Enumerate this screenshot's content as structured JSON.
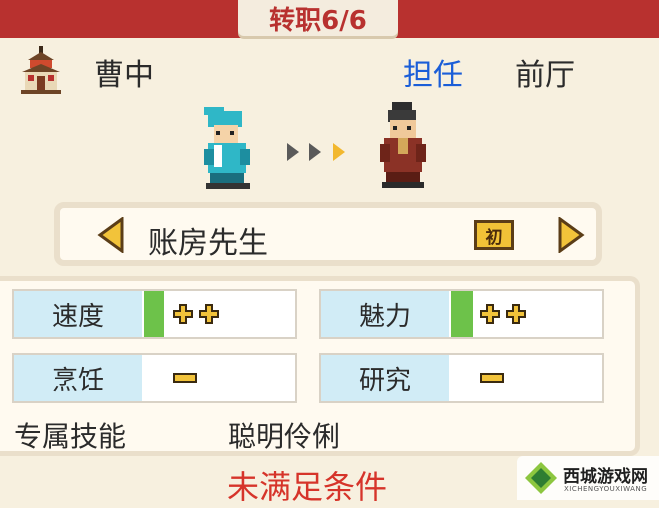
{
  "title": "转职6/6",
  "character": {
    "name": "曹中",
    "assign_label": "担任",
    "location": "前厅"
  },
  "job": {
    "name": "账房先生",
    "rank": "初"
  },
  "stats": [
    {
      "label": "速度",
      "value": "++",
      "has_bar": true
    },
    {
      "label": "魅力",
      "value": "++",
      "has_bar": true
    },
    {
      "label": "烹饪",
      "value": "-",
      "has_bar": false
    },
    {
      "label": "研究",
      "value": "-",
      "has_bar": false
    }
  ],
  "skill": {
    "label": "专属技能",
    "name": "聪明伶俐"
  },
  "condition": "未满足条件",
  "watermark": {
    "text": "西城游戏网",
    "sub": "XICHENGYOUXIWANG"
  },
  "colors": {
    "title_bar": "#b8312f",
    "accent_blue": "#1b5ed8",
    "condition_red": "#d6342a",
    "stat_label_bg": "#d1ecf6",
    "stat_bar_green": "#6dc24a",
    "rank_gold": "#f1c237"
  },
  "icons": {
    "building": "building-icon",
    "left_arrow": "triangle-left-icon",
    "right_arrow": "triangle-right-icon",
    "plus": "plus-icon",
    "minus": "minus-icon"
  }
}
